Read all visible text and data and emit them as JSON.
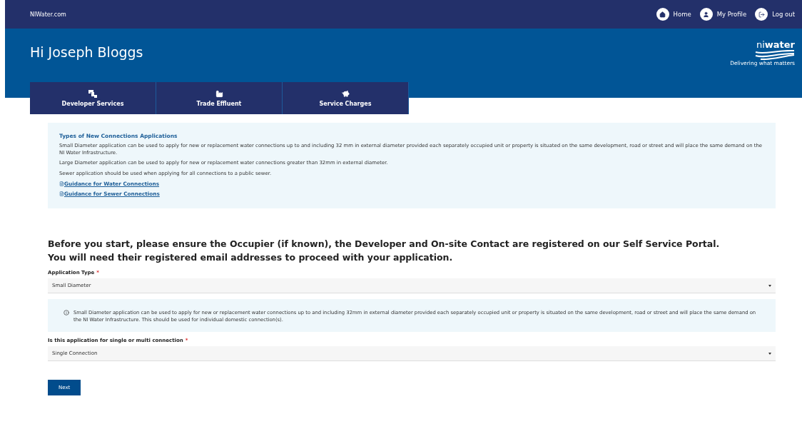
{
  "top_bar": {
    "site": "NIWater.com",
    "links": [
      {
        "label": "Home"
      },
      {
        "label": "My Profile"
      },
      {
        "label": "Log out"
      }
    ]
  },
  "header": {
    "greeting": "Hi Joseph Bloggs",
    "logo": {
      "wordmark_light": "ni",
      "wordmark_bold": "water",
      "tagline": "Delivering what matters"
    }
  },
  "tabs": [
    {
      "label": "Developer Services"
    },
    {
      "label": "Trade Effluent"
    },
    {
      "label": "Service Charges"
    }
  ],
  "info_panel": {
    "title": "Types of New Connections Applications",
    "paragraphs": [
      "Small Diameter application can be used to apply for new or replacement water connections up to and including 32 mm in external diameter provided each separately occupied unit or property is situated on the same development, road or street and will place the same demand on the NI Water Infrastructure.",
      "Large Diameter application can be used to apply for new or replacement water connections greater than 32mm in external diameter.",
      "Sewer application should be used when applying for all connections to a public sewer."
    ],
    "links": [
      "Guidance for Water Connections",
      "Guidance for Sewer Connections"
    ]
  },
  "notice": [
    "Before you start, please ensure the Occupier (if known), the Developer and On-site Contact are registered on our Self Service Portal.",
    "You will need their registered email addresses to proceed with your application."
  ],
  "form": [
    {
      "kind": "select",
      "label": "Application Type",
      "required_mark": "*",
      "value": "Small Diameter"
    },
    {
      "kind": "note",
      "text": "Small Diameter application can be used to apply for new or replacement water connections up to and including 32mm in external diameter provided each separately occupied unit or property is situated on the same development, road or street and will place the same demand on the NI Water Infrastructure. This should be used for individual domestic connection(s)."
    },
    {
      "kind": "select",
      "label": "Is this application for single or multi connection",
      "required_mark": "*",
      "value": "Single Connection"
    }
  ],
  "next_button": "Next"
}
